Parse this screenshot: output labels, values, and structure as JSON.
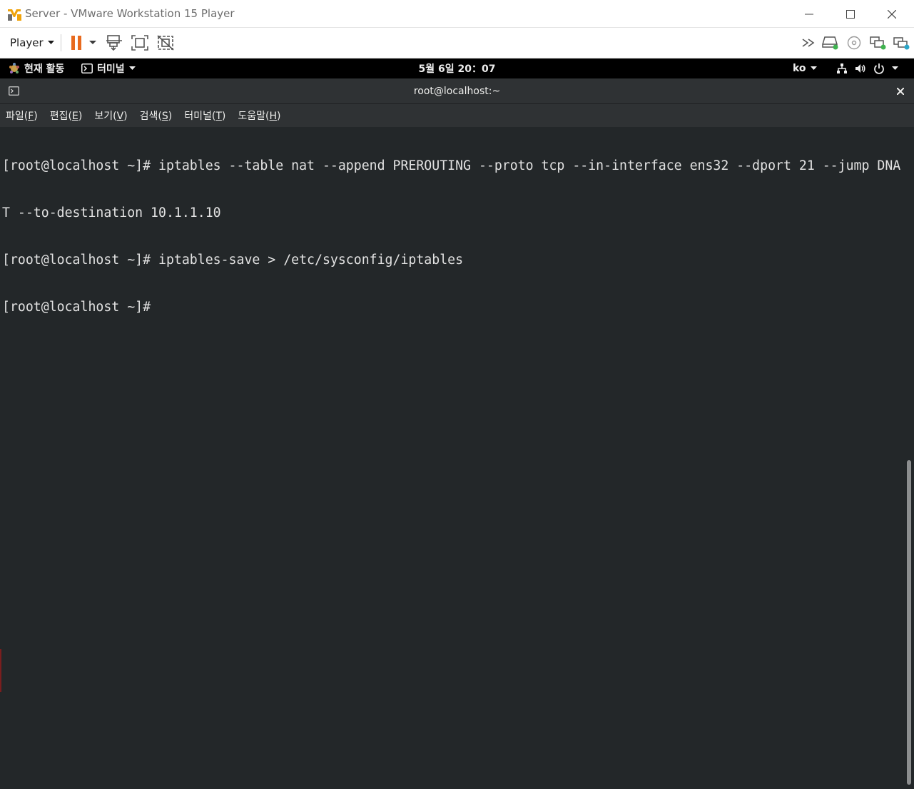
{
  "window": {
    "title": "Server - VMware Workstation 15 Player",
    "app_icon": "vmware-icon",
    "controls": [
      "minimize-icon",
      "maximize-icon",
      "close-icon"
    ]
  },
  "vm_toolbar": {
    "player_label": "Player",
    "pause_color": "#e86a1e",
    "left_icons": [
      "pause-icon",
      "send-ctrl-alt-del-icon",
      "fullscreen-icon",
      "unity-icon"
    ],
    "right_icons": [
      "collapse-icon",
      "hard-disk-icon",
      "cd-dvd-icon",
      "network-adapter-icon",
      "usb-device-icon"
    ]
  },
  "gnome_bar": {
    "activities_label": "현재 활동",
    "app_menu_label": "터미널",
    "clock": "5월 6일  20：07",
    "input_method": "ko",
    "status_icons": [
      "network-wired-icon",
      "volume-icon",
      "power-icon"
    ]
  },
  "terminal": {
    "title": "root@localhost:~",
    "menu": [
      {
        "label": "파일",
        "mnemonic": "F"
      },
      {
        "label": "편집",
        "mnemonic": "E"
      },
      {
        "label": "보기",
        "mnemonic": "V"
      },
      {
        "label": "검색",
        "mnemonic": "S"
      },
      {
        "label": "터미널",
        "mnemonic": "T"
      },
      {
        "label": "도움말",
        "mnemonic": "H"
      }
    ],
    "lines": [
      "[root@localhost ~]# iptables --table nat --append PREROUTING --proto tcp --in-interface ens32 --dport 21 --jump DNA",
      "T --to-destination 10.1.1.10",
      "[root@localhost ~]# iptables-save > /etc/sysconfig/iptables",
      "[root@localhost ~]#"
    ],
    "background": "#232729",
    "foreground": "#e2e2e2"
  }
}
